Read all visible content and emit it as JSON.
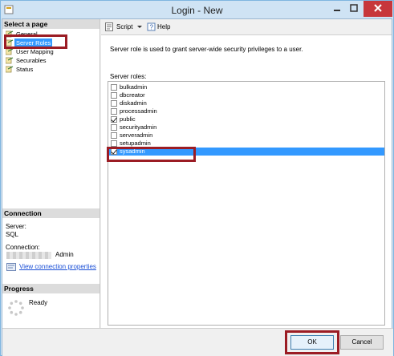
{
  "window": {
    "title": "Login - New"
  },
  "left": {
    "select_page_header": "Select a page",
    "pages": [
      {
        "label": "General",
        "selected": false
      },
      {
        "label": "Server Roles",
        "selected": true
      },
      {
        "label": "User Mapping",
        "selected": false
      },
      {
        "label": "Securables",
        "selected": false
      },
      {
        "label": "Status",
        "selected": false
      }
    ],
    "connection_header": "Connection",
    "server_label": "Server:",
    "server_value": "SQL",
    "connection_label": "Connection:",
    "connection_value": "Admin",
    "view_properties_link": "View connection properties",
    "progress_header": "Progress",
    "progress_status": "Ready"
  },
  "toolbar": {
    "script_label": "Script",
    "help_label": "Help"
  },
  "main": {
    "description": "Server role is used to grant server-wide security privileges to a user.",
    "roles_label": "Server roles:",
    "roles": [
      {
        "name": "bulkadmin",
        "checked": false,
        "selected": false
      },
      {
        "name": "dbcreator",
        "checked": false,
        "selected": false
      },
      {
        "name": "diskadmin",
        "checked": false,
        "selected": false
      },
      {
        "name": "processadmin",
        "checked": false,
        "selected": false
      },
      {
        "name": "public",
        "checked": true,
        "selected": false
      },
      {
        "name": "securityadmin",
        "checked": false,
        "selected": false
      },
      {
        "name": "serveradmin",
        "checked": false,
        "selected": false
      },
      {
        "name": "setupadmin",
        "checked": false,
        "selected": false
      },
      {
        "name": "sysadmin",
        "checked": true,
        "selected": true
      }
    ]
  },
  "footer": {
    "ok_label": "OK",
    "cancel_label": "Cancel"
  },
  "colors": {
    "selection": "#3399ff",
    "highlight_box": "#9b1c24",
    "link": "#1a4fd6"
  }
}
